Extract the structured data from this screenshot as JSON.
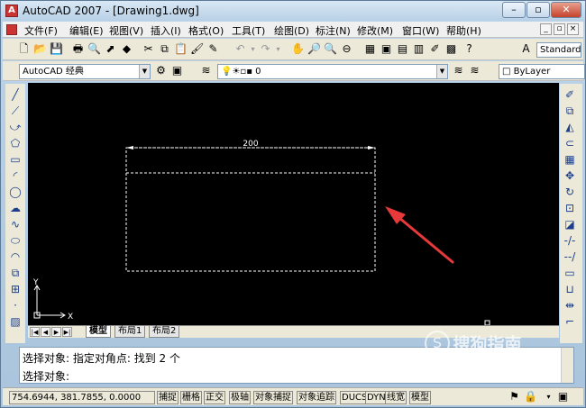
{
  "window": {
    "title": "AutoCAD 2007 - [Drawing1.dwg]"
  },
  "menu": [
    "文件(F)",
    "编辑(E)",
    "视图(V)",
    "插入(I)",
    "格式(O)",
    "工具(T)",
    "绘图(D)",
    "标注(N)",
    "修改(M)",
    "窗口(W)",
    "帮助(H)"
  ],
  "toolbar": {
    "text_style": "Standard"
  },
  "toolbar2": {
    "workspace": "AutoCAD 经典",
    "layer": "0",
    "color": "ByLayer"
  },
  "drawing": {
    "dimension_text": "200"
  },
  "ucs": {
    "x_label": "X",
    "y_label": "Y"
  },
  "tabs": [
    "模型",
    "布局1",
    "布局2"
  ],
  "command": {
    "history": "选择对象: 指定对角点: 找到 2 个",
    "prompt": "选择对象:"
  },
  "status": {
    "coords": "754.6944, 381.7855, 0.0000",
    "buttons": [
      "捕捉",
      "栅格",
      "正交",
      "极轴",
      "对象捕捉",
      "对象追踪",
      "DUCS",
      "DYN",
      "线宽",
      "模型"
    ]
  },
  "watermark": {
    "brand": "搜狗指南",
    "url": "zhinan.sogou.com"
  },
  "colors": {
    "canvas": "#000000",
    "selection": "#ffffff",
    "arrow": "#e8393a"
  }
}
